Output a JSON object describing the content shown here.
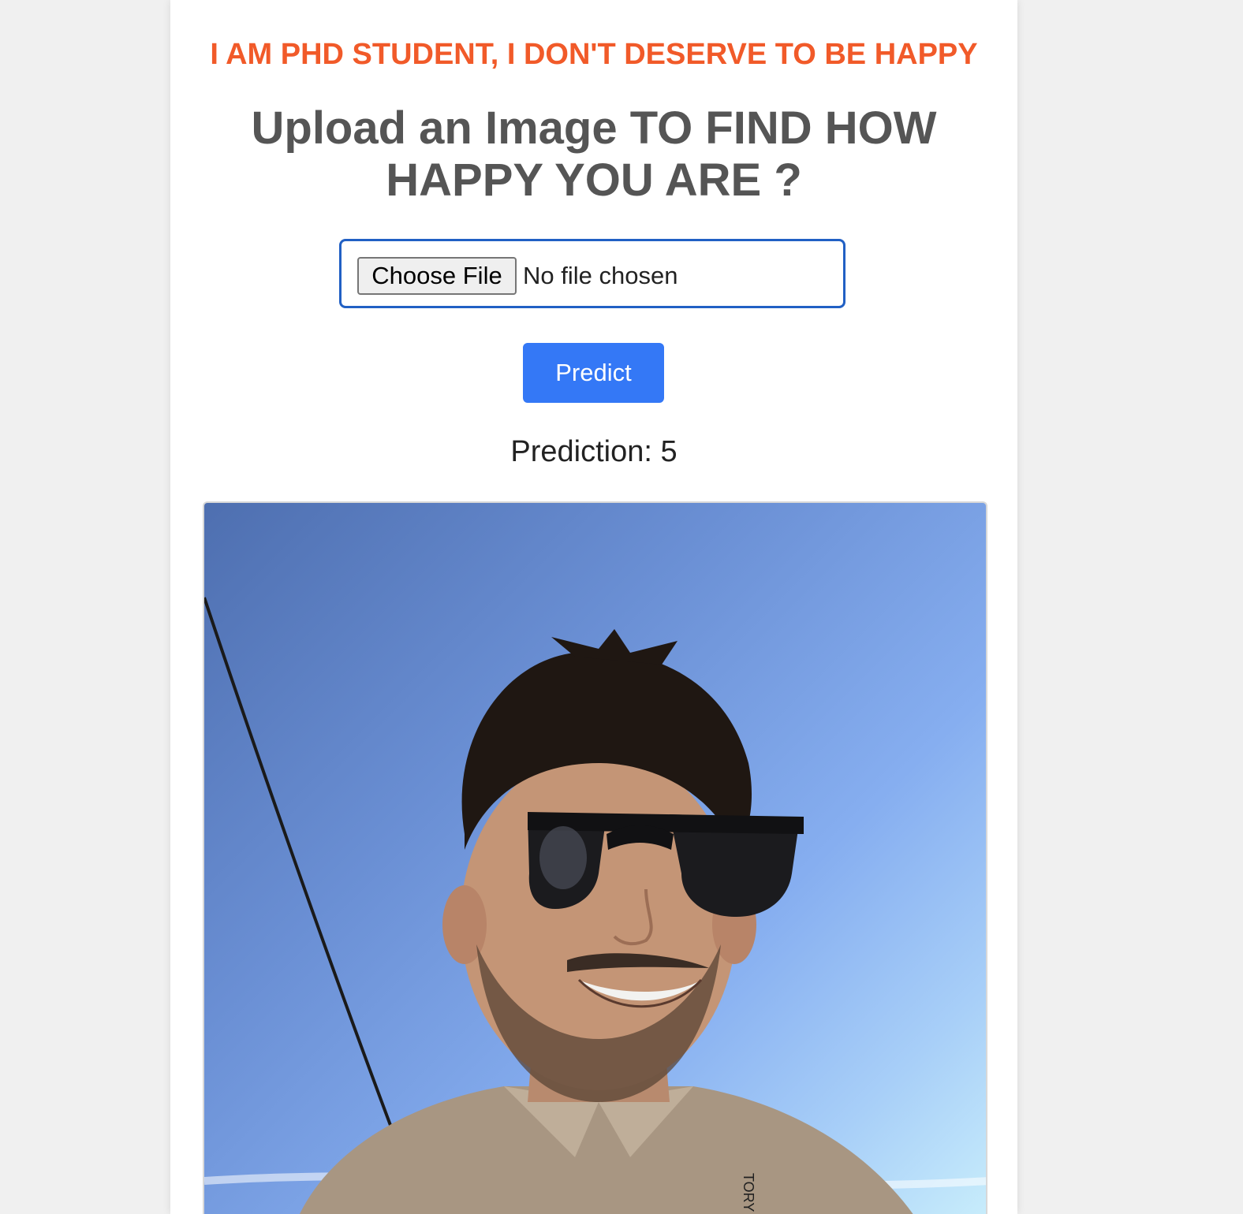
{
  "page": {
    "tagline": "I AM PHD STUDENT, I DON'T DESERVE TO BE HAPPY",
    "heading": "Upload an Image TO FIND HOW HAPPY YOU ARE ?"
  },
  "upload": {
    "choose_label": "Choose File",
    "status": "No file chosen"
  },
  "predict_button": {
    "label": "Predict"
  },
  "result": {
    "label": "Prediction:",
    "value": "5"
  },
  "photo": {
    "shirt_tag_text": "TORY"
  },
  "colors": {
    "tagline": "#f15a29",
    "heading": "#555555",
    "accent": "#3478f6",
    "file_border": "#2160c4",
    "background": "#f0f0f0"
  }
}
